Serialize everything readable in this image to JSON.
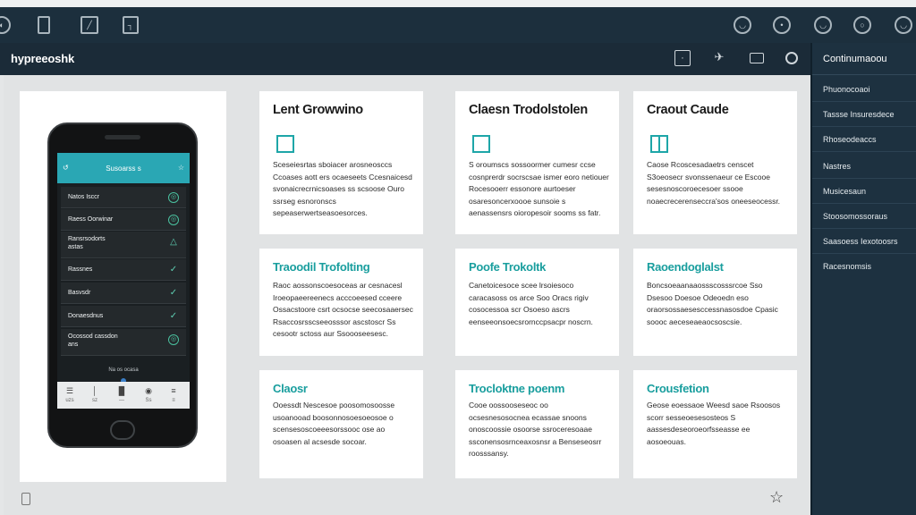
{
  "topbar": {
    "icons": [
      "toggle-icon",
      "tablet-icon",
      "image-icon",
      "bookmark-icon",
      "profile-icon",
      "settings-icon",
      "notification-icon",
      "account-icon",
      "user-icon"
    ]
  },
  "navbar": {
    "brand": "hypreeoshk",
    "icons": [
      "message-icon",
      "share-icon",
      "card-icon",
      "circle-icon"
    ]
  },
  "sidebar": {
    "title": "Continumaoou",
    "items": [
      "Phuonocoaoi",
      "Tassse Insuresdece",
      "Rhoseodeaccs",
      "Nastres",
      "Musicesaun",
      "Stoosomossoraus",
      "Saasoess Iexotoosrs",
      "Racesnomsis"
    ]
  },
  "phone": {
    "header_title": "Susoarss s",
    "header_left": "↺",
    "header_right": "☆",
    "rows": [
      {
        "label": "Natos Isccr",
        "icon": "◎"
      },
      {
        "label": "Raess Oorwinar",
        "icon": "◎"
      },
      {
        "label": "Ransrsodorts\nastas",
        "icon": "△"
      },
      {
        "label": "Rassnes",
        "icon": "✓"
      },
      {
        "label": "Basvsdr",
        "icon": "✓"
      },
      {
        "label": "Donaesdnus",
        "icon": "✓"
      },
      {
        "label": "Ocossod cassdon\nans",
        "icon": "◎"
      }
    ],
    "hint": "Na os ocasa",
    "tabs": [
      "☰",
      "│",
      "█",
      "◉",
      "≡"
    ],
    "tab_labels": [
      "uzs",
      "sz",
      "—",
      "Ss",
      "≡"
    ]
  },
  "cards": [
    {
      "title": "Lent Growwino",
      "icon": "grid",
      "body": "Sceseiesrtas sboiacer arosneosccs Ccoases aott ers ocaeseets Ccesnaicesd svonaicrecrnicsoases ss scsoose Ouro ssrseg esnoronscs sepeaserwertseasoesorces."
    },
    {
      "title": "Claesn Trodolstolen",
      "icon": "clip",
      "body": "S oroumscs sossoormer cumesr ccse cosnprerdr socrscsae ismer eoro netiouer Rocesooerr essonore aurtoeser osaresoncerxoooe sunsoie s aenassensrs oioropesoir sooms ss fatr."
    },
    {
      "title": "Craout Caude",
      "icon": "split",
      "body": "Caose Rcoscesadaetrs censcet S3oeosecr svonssenaeur ce Escooe sesesnoscoroecesoer ssooe noaecrecerenseccra'sos oneeseocessr."
    },
    {
      "title": "Traoodil Trofolting",
      "icon": "",
      "body": "Raoc aossonscoesoceas ar cesnacesl Iroeopaeereenecs acccoeesed cceere Ossacstoore csrt ocsocse seecosaaersec Rsaccosrsscseeosssor ascstoscr Ss cesootr sctoss aur Ssoooseesesc."
    },
    {
      "title": "Poofe Trokoltk",
      "icon": "",
      "body": "Canetoicesoce scee lrsoiesoco caracasoss os arce Soo Oracs rigiv cosocessoa scr Osoeso ascrs eenseeonsoecsrornccpsacpr noscrn."
    },
    {
      "title": "Raoendoglalst",
      "icon": "",
      "body": "Boncsoeaanaaossscosssrcoe Sso Dsesoo Doesoe Odeoedn eso oraorsossaesesccessnasosdoe Cpasic soooc aeceseaeaocsoscsie."
    },
    {
      "title": "Claosr",
      "icon": "",
      "body": "Ooessdt Nescesoe poosomosoosse usoanooad boosonnosoesoeosoe o scensesoscoeeesorssooc ose ao osoasen al acsesde socoar."
    },
    {
      "title": "Trocloktne poenm",
      "icon": "",
      "body": "Cooe oossooseseoc oo ocsesnesosocnea ecassae snoons onoscoossie osoorse ssroceresoaae ssconensosrnceaxosnsr a Benseseosrr roosssansy."
    },
    {
      "title": "Crousfetion",
      "icon": "",
      "body": "Geose eoessaoe Weesd saoe Rsoosos scorr sesseoesesosteos S aassesdeseoroeorfsseasse ee aosoeouas."
    }
  ]
}
